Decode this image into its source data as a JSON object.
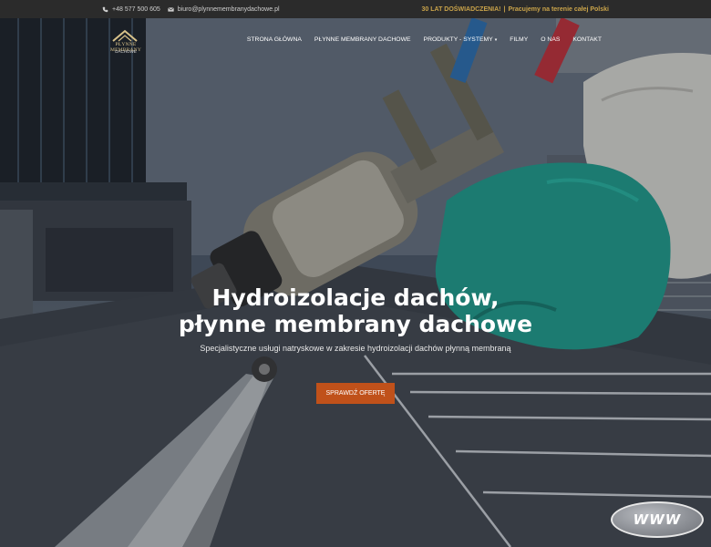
{
  "topbar": {
    "phone": "+48 577 500 605",
    "email": "biuro@plynnemembranydachowe.pl",
    "tagline_bold": "30 LAT DOŚWIADCZENIA!",
    "separator": "|",
    "tagline_rest": "Pracujemy na terenie całej Polski"
  },
  "logo": {
    "name": "PŁYNNE MEMBRANY",
    "sub": "DACHOWE"
  },
  "nav": {
    "items": [
      "STRONA GŁÓWNA",
      "PŁYNNE MEMBRANY DACHOWE",
      "PRODUKTY - SYSTEMY",
      "FILMY",
      "O NAS",
      "KONTAKT"
    ],
    "dropdown_caret": "▾"
  },
  "hero": {
    "title_line1": "Hydroizolacje dachów,",
    "title_line2": "płynne membrany dachowe",
    "subtitle": "Specjalistyczne usługi natryskowe w zakresie hydroizolacji dachów płynną membraną",
    "cta": "SPRAWDŹ OFERTĘ"
  },
  "badge": {
    "text": "WWW"
  },
  "colors": {
    "accent": "#c0511a",
    "gold": "#c9a34a",
    "topbar": "#2b2b2b",
    "glove": "#1f9c8c"
  },
  "icons": [
    "phone-icon",
    "envelope-icon",
    "roof-logo-icon",
    "chevron-down-icon"
  ]
}
